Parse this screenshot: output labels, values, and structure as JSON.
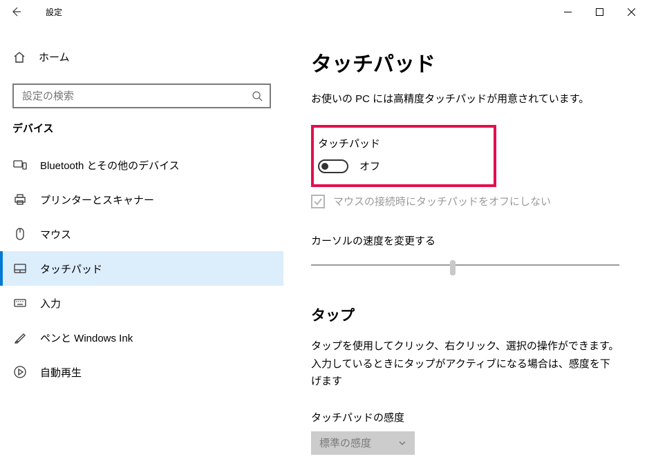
{
  "titlebar": {
    "title": "設定"
  },
  "sidebar": {
    "home": "ホーム",
    "search_placeholder": "設定の検索",
    "section": "デバイス",
    "items": [
      {
        "label": "Bluetooth とその他のデバイス"
      },
      {
        "label": "プリンターとスキャナー"
      },
      {
        "label": "マウス"
      },
      {
        "label": "タッチパッド"
      },
      {
        "label": "入力"
      },
      {
        "label": "ペンと Windows Ink"
      },
      {
        "label": "自動再生"
      }
    ]
  },
  "main": {
    "heading": "タッチパッド",
    "description": "お使いの PC には高精度タッチパッドが用意されています。",
    "toggle_label": "タッチパッド",
    "toggle_state": "オフ",
    "checkbox_label": "マウスの接続時にタッチパッドをオフにしない",
    "cursor_speed_label": "カーソルの速度を変更する",
    "tap_heading": "タップ",
    "tap_desc": "タップを使用してクリック、右クリック、選択の操作ができます。入力しているときにタップがアクティブになる場合は、感度を下げます",
    "sensitivity_label": "タッチパッドの感度",
    "sensitivity_value": "標準の感度"
  }
}
